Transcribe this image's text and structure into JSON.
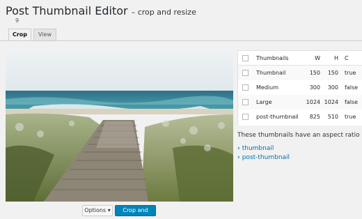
{
  "page": {
    "title": "Post Thumbnail Editor",
    "subtitle": "– crop and resize",
    "post_id": "9"
  },
  "tabs": [
    {
      "label": "Crop",
      "active": true
    },
    {
      "label": "View",
      "active": false
    }
  ],
  "buttons": {
    "options": "Options ▾",
    "save": "Crop and Save"
  },
  "table": {
    "headers": {
      "name": "Thumbnails",
      "w": "W",
      "h": "H",
      "c": "C"
    },
    "rows": [
      {
        "name": "Thumbnail",
        "w": "150",
        "h": "150",
        "c": "true"
      },
      {
        "name": "Medium",
        "w": "300",
        "h": "300",
        "c": "false"
      },
      {
        "name": "Large",
        "w": "1024",
        "h": "1024",
        "c": "false"
      },
      {
        "name": "post-thumbnail",
        "w": "825",
        "h": "510",
        "c": "true"
      }
    ]
  },
  "aspect_note": "These thumbnails have an aspect ratio set:",
  "links": [
    "thumbnail",
    "post-thumbnail"
  ],
  "colors": {
    "primary_button": "#0085ba",
    "link": "#0073aa",
    "background": "#f1f1f1"
  }
}
